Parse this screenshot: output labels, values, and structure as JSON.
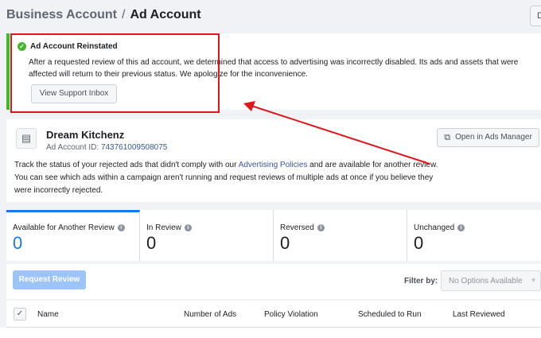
{
  "header": {
    "breadcrumb_parent": "Business Account",
    "breadcrumb_separator": "/",
    "breadcrumb_current": "Ad Account",
    "corner_button_label": "D"
  },
  "notice": {
    "icon": "check-circle-icon",
    "title": "Ad Account Reinstated",
    "body": "After a requested review of this ad account, we determined that access to advertising was incorrectly disabled. Its ads and assets that were affected will return to their previous status. We apologize for the inconvenience.",
    "button_label": "View Support Inbox",
    "accent_color": "#42b72a"
  },
  "annotation": {
    "color": "#e0161d"
  },
  "account": {
    "name": "Dream Kitchenz",
    "id_label": "Ad Account ID:",
    "id_value": "743761009508075",
    "open_button_label": "Open in Ads Manager",
    "description_before_link": "Track the status of your rejected ads that didn't comply with our ",
    "policy_link": "Advertising Policies",
    "description_after_link": " and are available for another review. You can see which ads within a campaign aren't running and request reviews of multiple ads at once if you believe they were incorrectly rejected."
  },
  "stats": [
    {
      "label": "Available for Another Review",
      "value": "0",
      "active": true
    },
    {
      "label": "In Review",
      "value": "0",
      "active": false
    },
    {
      "label": "Reversed",
      "value": "0",
      "active": false
    },
    {
      "label": "Unchanged",
      "value": "0",
      "active": false
    }
  ],
  "controls": {
    "request_button_label": "Request Review",
    "filter_label": "Filter by:",
    "filter_value": "No Options Available"
  },
  "table": {
    "columns": [
      "Name",
      "Number of Ads",
      "Policy Violation",
      "Scheduled to Run",
      "Last Reviewed"
    ]
  },
  "colors": {
    "primary_blue": "#1877f2",
    "link_blue": "#385898",
    "disabled_blue": "#9cc4f8"
  }
}
